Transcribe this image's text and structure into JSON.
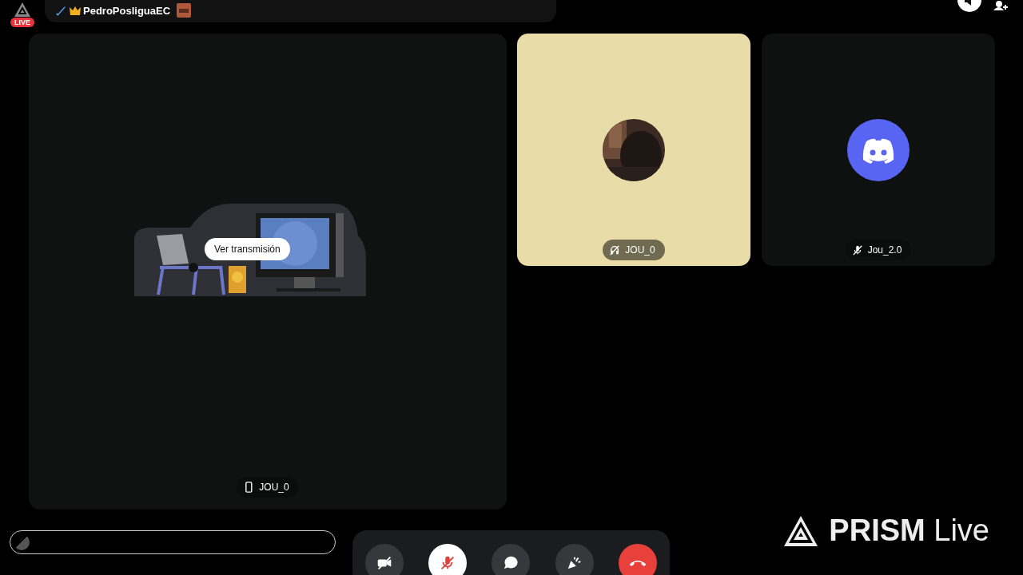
{
  "header": {
    "live_badge": "LIVE",
    "user": "PedroPosliguaEC"
  },
  "tiles": [
    {
      "kind": "stream",
      "name": "JOU_0",
      "on_mobile": true,
      "button": "Ver transmisión"
    },
    {
      "kind": "user",
      "name": "JOU_0",
      "deafened": true,
      "color": "#e8dca8",
      "has_avatar": true
    },
    {
      "kind": "user",
      "name": "Jou_2.0",
      "muted": true,
      "color": "#0e1110",
      "has_avatar": false
    }
  ],
  "controls": [
    {
      "kind": "camera",
      "on": false
    },
    {
      "kind": "mic",
      "on": false
    },
    {
      "kind": "chat"
    },
    {
      "kind": "activity"
    },
    {
      "kind": "leave"
    }
  ],
  "branding": {
    "bold": "PRISM",
    "light": "Live"
  }
}
